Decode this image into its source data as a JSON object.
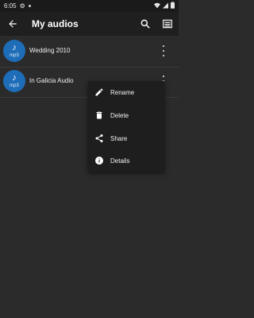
{
  "statusbar": {
    "time": "6:05"
  },
  "appbar": {
    "title": "My audios"
  },
  "list": {
    "items": [
      {
        "name": "Wedding 2010",
        "format": "mp3"
      },
      {
        "name": "In Galicia Audio",
        "format": "mp3"
      }
    ]
  },
  "context_menu": {
    "items": [
      {
        "label": "Rename",
        "icon": "pencil-icon"
      },
      {
        "label": "Delete",
        "icon": "trash-icon"
      },
      {
        "label": "Share",
        "icon": "share-icon"
      },
      {
        "label": "Details",
        "icon": "info-icon"
      }
    ]
  },
  "colors": {
    "accent": "#1e6db8",
    "background": "#2b2b2b",
    "appbar": "#1f1f1f"
  }
}
